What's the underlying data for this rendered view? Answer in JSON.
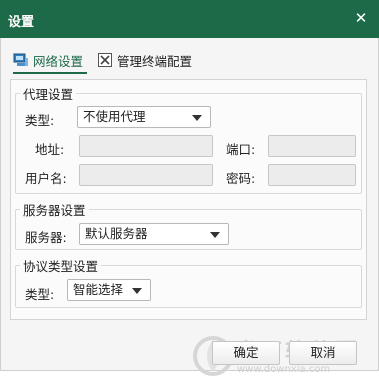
{
  "window": {
    "title": "设置",
    "close_glyph": "✕"
  },
  "tabs": [
    {
      "label": "网络设置",
      "icon": "network-settings-icon",
      "active": true
    },
    {
      "label": "管理终端配置",
      "icon": "tools-icon",
      "active": false
    }
  ],
  "proxy": {
    "legend": "代理设置",
    "type_label": "类型:",
    "type_value": "不使用代理",
    "address_label": "地址:",
    "address_value": "",
    "port_label": "端口:",
    "port_value": "",
    "username_label": "用户名:",
    "username_value": "",
    "password_label": "密码:",
    "password_value": ""
  },
  "server": {
    "legend": "服务器设置",
    "label": "服务器:",
    "value": "默认服务器"
  },
  "protocol": {
    "legend": "协议类型设置",
    "label": "类型:",
    "value": "智能选择"
  },
  "buttons": {
    "ok": "确定",
    "cancel": "取消"
  },
  "watermark": {
    "brand": "当下软件园",
    "url": "www.downxia.com"
  },
  "colors": {
    "accent": "#1d6a49",
    "watermark": "#d2d2d2"
  }
}
